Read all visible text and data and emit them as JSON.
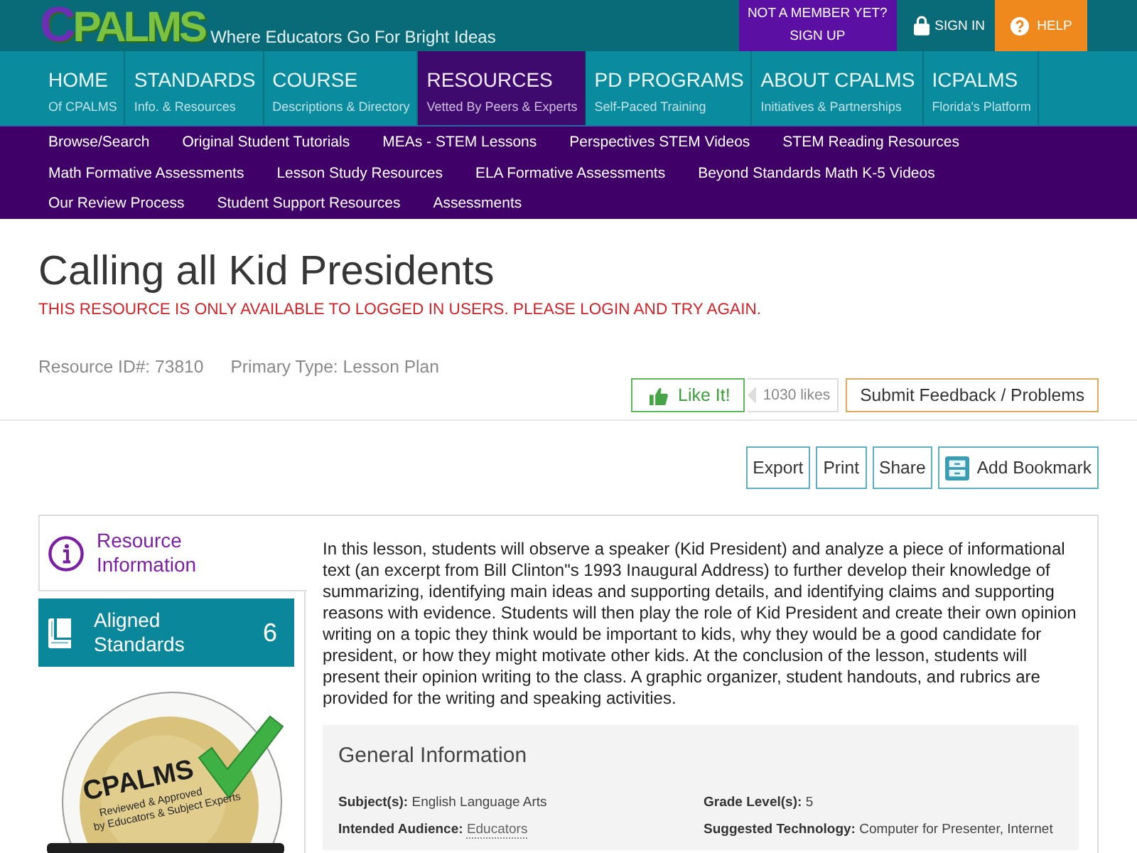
{
  "header": {
    "logo": "CPALMS",
    "tagline": "Where Educators Go For Bright Ideas",
    "member_prompt": "NOT A MEMBER YET?",
    "sign_up": "SIGN UP",
    "sign_in": "SIGN IN",
    "help": "HELP"
  },
  "main_nav": [
    {
      "label": "HOME",
      "sublabel": "Of CPALMS",
      "selected": false
    },
    {
      "label": "STANDARDS",
      "sublabel": "Info. & Resources",
      "selected": false
    },
    {
      "label": "COURSE",
      "sublabel": "Descriptions & Directory",
      "selected": false
    },
    {
      "label": "RESOURCES",
      "sublabel": "Vetted By Peers & Experts",
      "selected": true
    },
    {
      "label": "PD PROGRAMS",
      "sublabel": "Self-Paced Training",
      "selected": false
    },
    {
      "label": "ABOUT CPALMS",
      "sublabel": "Initiatives & Partnerships",
      "selected": false
    },
    {
      "label": "ICPALMS",
      "sublabel": "Florida's Platform",
      "selected": false
    }
  ],
  "sub_nav": [
    [
      "Browse/Search",
      "Original Student Tutorials",
      "MEAs - STEM Lessons",
      "Perspectives STEM Videos",
      "STEM Reading Resources"
    ],
    [
      "Math Formative Assessments",
      "Lesson Study Resources",
      "ELA Formative Assessments",
      "Beyond Standards Math K-5 Videos"
    ],
    [
      "Our Review Process",
      "Student Support Resources",
      "Assessments"
    ]
  ],
  "resource": {
    "title": "Calling all Kid Presidents",
    "notice": "THIS RESOURCE IS ONLY AVAILABLE TO LOGGED IN USERS. PLEASE LOGIN AND TRY AGAIN.",
    "resource_id": "Resource ID#: 73810",
    "primary_type": "Primary Type: Lesson Plan",
    "like_button": "Like It!",
    "like_count": "1030 likes",
    "feedback_button": "Submit Feedback / Problems",
    "actions": [
      {
        "label": "Export",
        "kind": "plain"
      },
      {
        "label": "Print",
        "kind": "plain"
      },
      {
        "label": "Share",
        "kind": "plain"
      },
      {
        "label": "Add Bookmark",
        "kind": "bookmark"
      }
    ]
  },
  "side_tabs": [
    {
      "label": "Resource Information",
      "kind": "info",
      "selected": true
    },
    {
      "label": "Aligned Standards",
      "kind": "standards",
      "count": "6",
      "selected": false
    }
  ],
  "seal": {
    "logo": "CPALMS",
    "caption": [
      "Reviewed & Approved",
      "by Educators & Subject Experts"
    ]
  },
  "description": "In this lesson, students will observe a speaker (Kid President) and analyze a piece of informational text (an excerpt from Bill Clinton\"s 1993 Inaugural Address) to further develop their knowledge of summarizing, identifying main ideas and supporting details, and identifying claims and supporting reasons with evidence. Students will then play the role of Kid President and create their own opinion writing on a topic they think would be important to kids, why they would be a good candidate for president, or how they might motivate other kids. At the conclusion of the lesson, students will present their opinion writing to the class. A graphic organizer, student handouts, and rubrics are provided for the writing and speaking activities.",
  "general_information": {
    "heading": "General Information",
    "fields": [
      {
        "label": "Subject(s):",
        "value": "English Language Arts",
        "kind": "text"
      },
      {
        "label": "Grade Level(s):",
        "value": "5",
        "kind": "text"
      },
      {
        "label": "Intended Audience:",
        "value": "Educators",
        "kind": "link"
      },
      {
        "label": "Suggested Technology:",
        "value": "Computer for Presenter, Internet",
        "kind": "text"
      }
    ]
  }
}
